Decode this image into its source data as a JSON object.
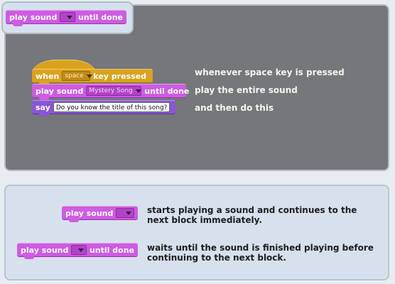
{
  "tab_block": {
    "prefix": "play sound",
    "dropdown_value": "",
    "suffix": "until done"
  },
  "script_example": {
    "hat": {
      "prefix": "when",
      "key": "space",
      "suffix": "key pressed"
    },
    "play": {
      "prefix": "play sound",
      "sound": "Mystery Song",
      "suffix": "until done"
    },
    "say": {
      "prefix": "say",
      "text": "Do you know the title of this song?"
    },
    "notes": [
      "whenever space key is pressed",
      "play the entire sound",
      "and then do this"
    ]
  },
  "comparison": {
    "play_sound": {
      "label": "play sound",
      "dropdown_value": "",
      "description": "starts playing a sound and continues to the next block immediately."
    },
    "play_until_done": {
      "prefix": "play sound",
      "dropdown_value": "",
      "suffix": "until done",
      "description": "waits until the sound is finished playing before continuing to the next block."
    }
  },
  "colors": {
    "sound_block": "#cd5ce2",
    "looks_block": "#8a55d7",
    "events_block": "#d9a21e",
    "dark_panel": "#75777a",
    "light_panel": "#d7e1ee"
  },
  "icons": {
    "dropdown": "caret-down-icon"
  }
}
